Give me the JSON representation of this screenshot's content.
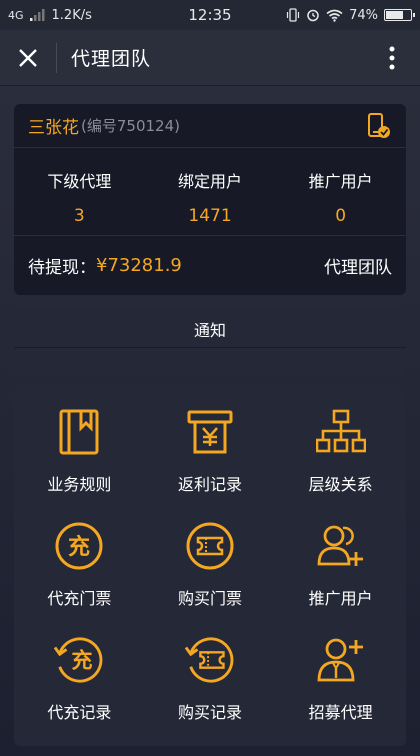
{
  "status_bar": {
    "network": "4G",
    "speed": "1.2K/s",
    "time": "12:35",
    "battery": "74%",
    "battery_level": 0.74
  },
  "header": {
    "title": "代理团队"
  },
  "agent": {
    "name": "三张花",
    "id_text": "(编号750124)"
  },
  "stats": [
    {
      "label": "下级代理",
      "value": "3"
    },
    {
      "label": "绑定用户",
      "value": "1471"
    },
    {
      "label": "推广用户",
      "value": "0"
    }
  ],
  "withdraw": {
    "label": "待提现：",
    "amount": "¥73281.9",
    "team_link": "代理团队"
  },
  "notice": {
    "title": "通知"
  },
  "menu": [
    {
      "label": "业务规则",
      "icon": "book-icon"
    },
    {
      "label": "返利记录",
      "icon": "rebate-icon"
    },
    {
      "label": "层级关系",
      "icon": "hierarchy-icon"
    },
    {
      "label": "代充门票",
      "icon": "recharge-icon"
    },
    {
      "label": "购买门票",
      "icon": "ticket-icon"
    },
    {
      "label": "推广用户",
      "icon": "add-users-icon"
    },
    {
      "label": "代充记录",
      "icon": "recharge-history-icon"
    },
    {
      "label": "购买记录",
      "icon": "purchase-history-icon"
    },
    {
      "label": "招募代理",
      "icon": "recruit-agent-icon"
    }
  ],
  "colors": {
    "accent": "#f4a721",
    "background": "#1f2230",
    "card": "#171a26"
  }
}
